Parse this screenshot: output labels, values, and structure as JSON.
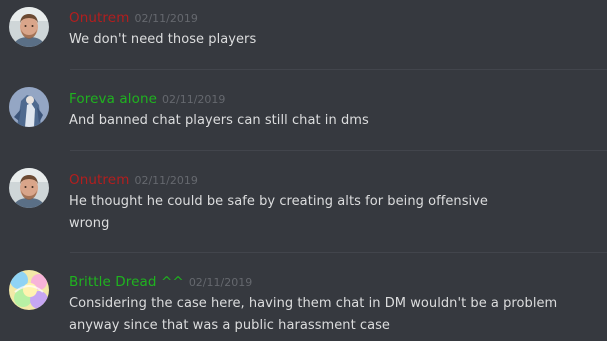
{
  "messages": [
    {
      "username": "Onutrem",
      "username_color": "#b31e1e",
      "timestamp": "02/11/2019",
      "lines": [
        "We don't need those players"
      ],
      "avatar": "avatar-photo-man"
    },
    {
      "username": "Foreva alone",
      "username_color": "#1fb31f",
      "timestamp": "02/11/2019",
      "lines": [
        "And banned chat players can still chat in dms"
      ],
      "avatar": "avatar-anime-figure"
    },
    {
      "username": "Onutrem",
      "username_color": "#b31e1e",
      "timestamp": "02/11/2019",
      "lines": [
        "He thought he could be safe by creating alts for being offensive",
        "wrong"
      ],
      "avatar": "avatar-photo-man"
    },
    {
      "username": "Brittle Dread ^^",
      "username_color": "#1fb31f",
      "timestamp": "02/11/2019",
      "lines": [
        "Considering the case here, having them chat in DM wouldn't be a problem",
        "anyway since that was a public harassment case"
      ],
      "avatar": "avatar-colorful-art"
    }
  ],
  "colors": {
    "background": "#36393f",
    "message_text": "#dcddde",
    "timestamp": "#65686e",
    "divider": "#42454c"
  }
}
